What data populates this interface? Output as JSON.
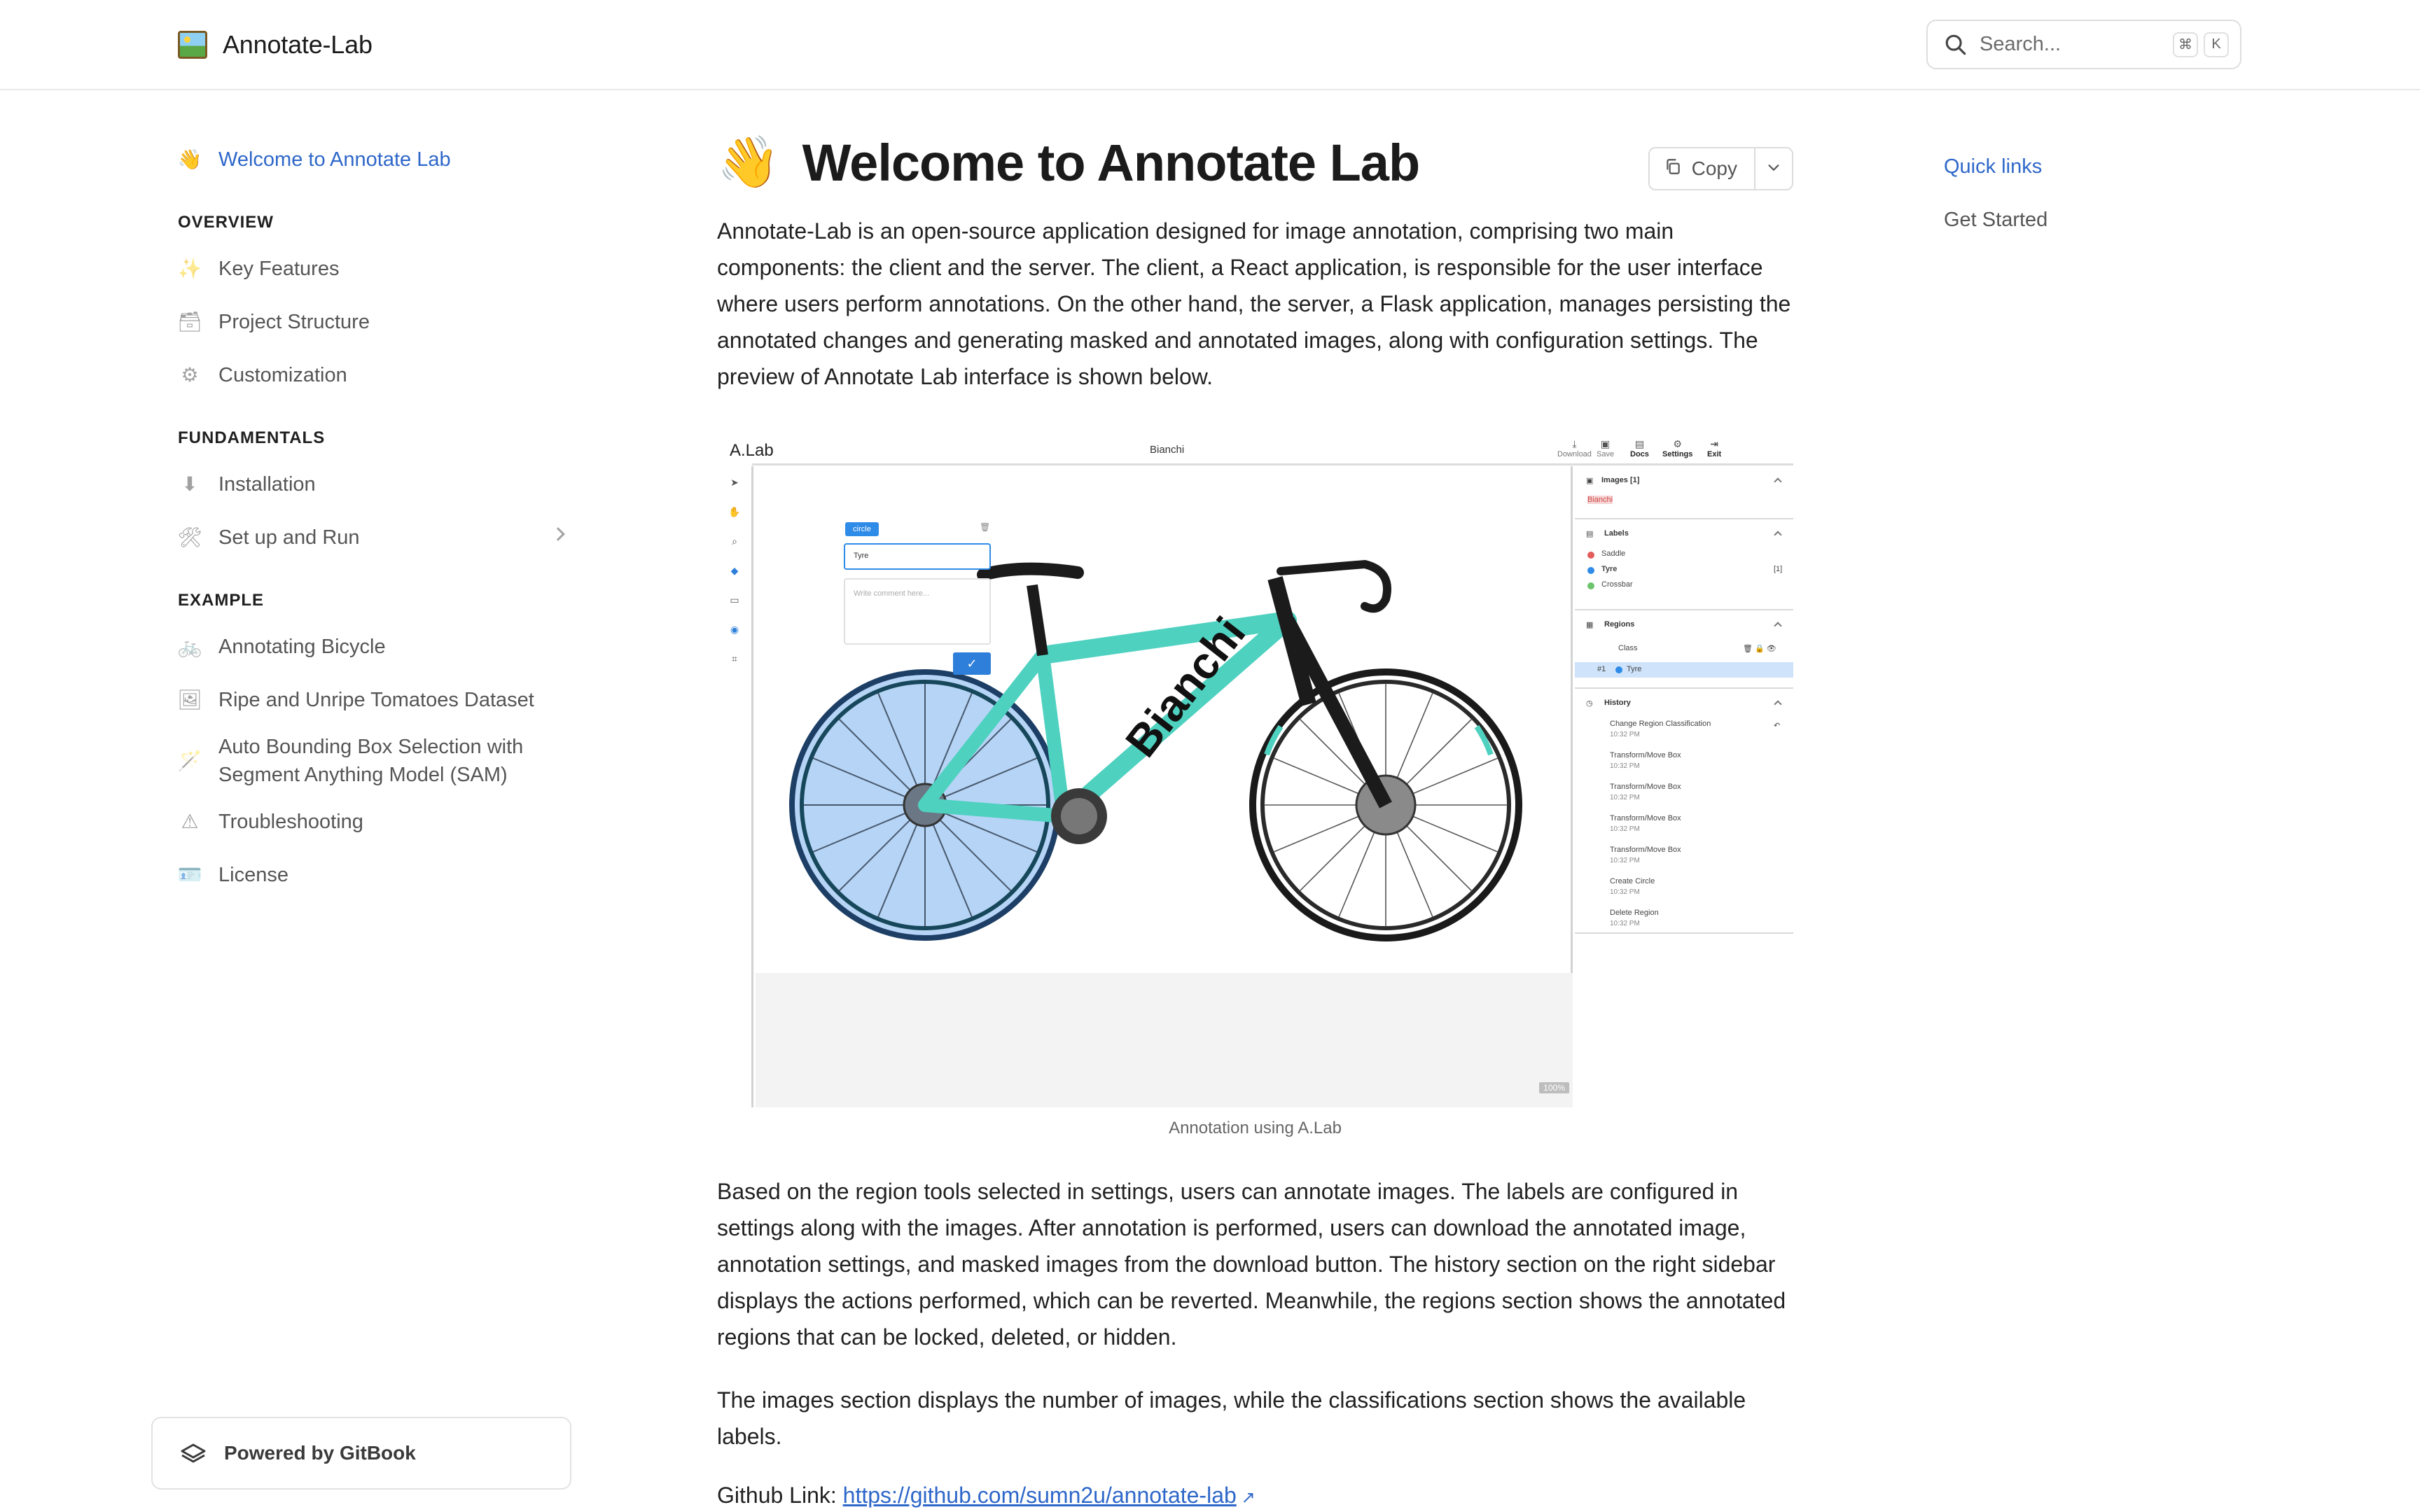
{
  "header": {
    "brand": "Annotate-Lab",
    "search_placeholder": "Search...",
    "kbd": [
      "⌘",
      "K"
    ]
  },
  "sidebar": {
    "top_item": {
      "label": "Welcome to Annotate Lab",
      "icon": "waving-hand-icon"
    },
    "sections": [
      {
        "title": "OVERVIEW",
        "items": [
          {
            "label": "Key Features",
            "icon": "sparkles-icon"
          },
          {
            "label": "Project Structure",
            "icon": "card-index-icon"
          },
          {
            "label": "Customization",
            "icon": "gear-icon"
          }
        ]
      },
      {
        "title": "FUNDAMENTALS",
        "items": [
          {
            "label": "Installation",
            "icon": "down-arrow-icon"
          },
          {
            "label": "Set up and Run",
            "icon": "hammer-wrench-icon"
          }
        ]
      },
      {
        "title": "EXAMPLE",
        "items": [
          {
            "label": "Annotating Bicycle",
            "icon": "bicycle-icon"
          },
          {
            "label": "Ripe and Unripe Tomatoes Dataset",
            "icon": "framed-picture-icon"
          },
          {
            "label": "Auto Bounding Box Selection with Segment Anything Model (SAM)",
            "icon": "magic-wand-icon"
          },
          {
            "label": "Troubleshooting",
            "icon": "warning-icon"
          },
          {
            "label": "License",
            "icon": "id-card-icon"
          }
        ]
      }
    ],
    "powered_by": "Powered by GitBook"
  },
  "main": {
    "title_emoji": "👋",
    "title": "Welcome to Annotate Lab",
    "copy_label": "Copy",
    "intro": "Annotate-Lab is an open-source application designed for image annotation, comprising two main components: the client and the server. The client, a React application, is responsible for the user interface where users perform annotations. On the other hand, the server, a Flask application, manages persisting the annotated changes and generating masked and annotated images, along with configuration settings. The preview of Annotate Lab interface is shown below.",
    "figure_caption": "Annotation using A.Lab",
    "para2": "Based on the region tools selected in settings, users can annotate images. The labels are configured in settings along with the images. After annotation is performed, users can download the annotated image, annotation settings, and masked images from the download button. The history section on the right sidebar displays the actions performed, which can be reverted. Meanwhile, the regions section shows the annotated regions that can be locked, deleted, or hidden.",
    "para3": "The images section displays the number of images, while the classifications section shows the available labels.",
    "github_prefix": "Github Link: ",
    "github_link": "https://github.com/sumn2u/annotate-lab"
  },
  "rail": {
    "title": "Quick links",
    "items": [
      "Get Started"
    ]
  },
  "preview": {
    "app_title": "A.Lab",
    "file_name": "Bianchi",
    "toolbar": [
      "Download",
      "Save",
      "Docs",
      "Settings",
      "Exit"
    ],
    "popup": {
      "chip": "circle",
      "select_value": "Tyre",
      "comment_placeholder": "Write comment here..."
    },
    "images_header": "Images [1]",
    "images_item": "Bianchi",
    "labels_header": "Labels",
    "labels": [
      {
        "name": "Saddle",
        "color": "#e45c5c"
      },
      {
        "name": "Tyre",
        "color": "#2e8be8",
        "count": "[1]"
      },
      {
        "name": "Crossbar",
        "color": "#6cc46c"
      }
    ],
    "regions_header": "Regions",
    "regions_class": "Class",
    "regions_row": {
      "id": "#1",
      "name": "Tyre"
    },
    "history_header": "History",
    "history": [
      {
        "action": "Change Region Classification",
        "time": "10:32 PM"
      },
      {
        "action": "Transform/Move Box",
        "time": "10:32 PM"
      },
      {
        "action": "Transform/Move Box",
        "time": "10:32 PM"
      },
      {
        "action": "Transform/Move Box",
        "time": "10:32 PM"
      },
      {
        "action": "Transform/Move Box",
        "time": "10:32 PM"
      },
      {
        "action": "Create Circle",
        "time": "10:32 PM"
      },
      {
        "action": "Delete Region",
        "time": "10:32 PM"
      }
    ],
    "zoom": "100%",
    "bike_brand": "Bianchi"
  },
  "colors": {
    "accent": "#2e67c9",
    "bike_celeste": "#4fd1c0",
    "region_fill": "#a9cdf5"
  }
}
